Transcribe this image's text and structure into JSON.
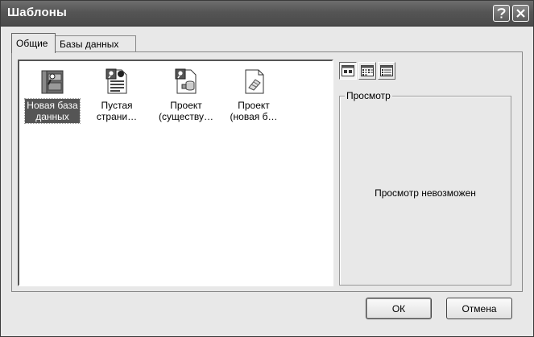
{
  "window": {
    "title": "Шаблоны"
  },
  "tabs": [
    {
      "label": "Общие",
      "active": true
    },
    {
      "label": "Базы данных",
      "active": false
    }
  ],
  "items": [
    {
      "label": "Новая база\nданных",
      "icon": "new-database-icon",
      "selected": true
    },
    {
      "label": "Пустая\nстрани…",
      "icon": "blank-page-icon",
      "selected": false
    },
    {
      "label": "Проект\n(существу…",
      "icon": "project-existing-icon",
      "selected": false
    },
    {
      "label": "Проект\n(новая б…",
      "icon": "project-new-icon",
      "selected": false
    }
  ],
  "view_buttons": [
    "large-icons-view-icon",
    "list-view-icon",
    "details-view-icon"
  ],
  "preview": {
    "label": "Просмотр",
    "message": "Просмотр невозможен"
  },
  "buttons": {
    "ok": "ОК",
    "cancel": "Отмена"
  }
}
